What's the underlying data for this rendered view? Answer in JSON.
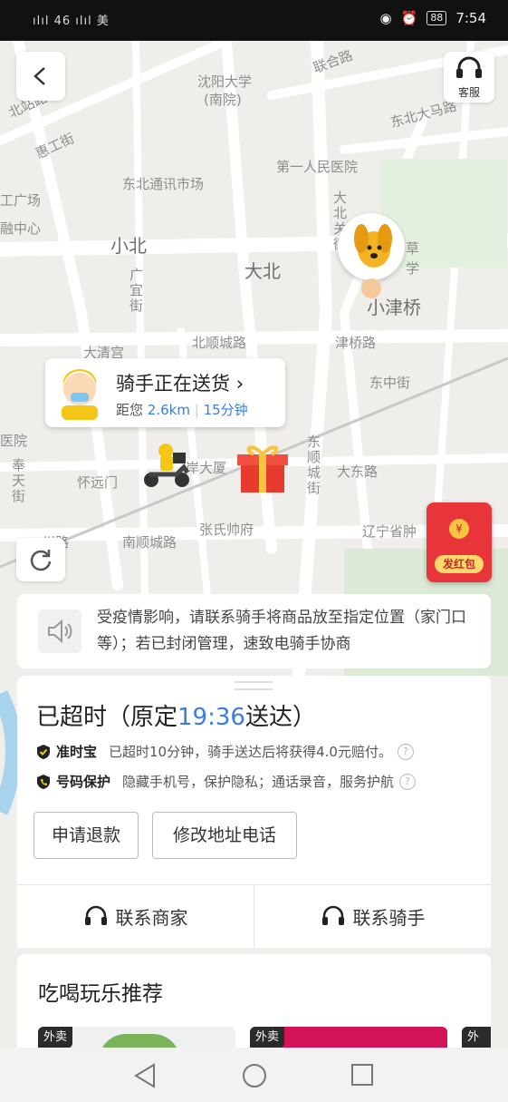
{
  "status_bar": {
    "signal": "ılıl 46 ılıl 美",
    "battery": "88",
    "time": "7:54"
  },
  "map": {
    "labels": [
      "沈阳大学",
      "(南院)",
      "联合路",
      "东北大马路",
      "北站路",
      "惠工街",
      "第一人民医院",
      "东北通讯市场",
      "工广场",
      "融中心",
      "小北",
      "大北",
      "大北关街",
      "小津桥",
      "广宜街",
      "大清宫",
      "北顺城路",
      "津桥路",
      "东中街",
      "医院",
      "奉天街",
      "怀远门",
      "岸大厦",
      "东顺城街",
      "大东路",
      "州路",
      "南顺城路",
      "张氏帅府",
      "辽宁省肿",
      "草",
      "学"
    ]
  },
  "buttons": {
    "service_label": "客服"
  },
  "rider": {
    "status": "骑手正在送货",
    "distance_prefix": "距您",
    "distance": "2.6km",
    "eta": "15分钟"
  },
  "red_packet": {
    "label": "发红包",
    "coin": "¥"
  },
  "notice": {
    "text": "受疫情影响，请联系骑手将商品放至指定位置（家门口等）；若已封闭管理，速致电骑手协商"
  },
  "order": {
    "title_prefix": "已超时（原定",
    "scheduled_time": "19:36",
    "title_suffix": "送达）",
    "ontime_label": "准时宝",
    "ontime_text": "已超时10分钟，骑手送达后将获得4.0元赔付。",
    "privacy_label": "号码保护",
    "privacy_text": "隐藏手机号，保护隐私；通话录音，服务护航",
    "refund_button": "申请退款",
    "modify_button": "修改地址电话",
    "contact_merchant": "联系商家",
    "contact_rider": "联系骑手",
    "help_icon": "?"
  },
  "recommend": {
    "title": "吃喝玩乐推荐",
    "tags": [
      "外卖",
      "外卖",
      "外卖"
    ]
  }
}
